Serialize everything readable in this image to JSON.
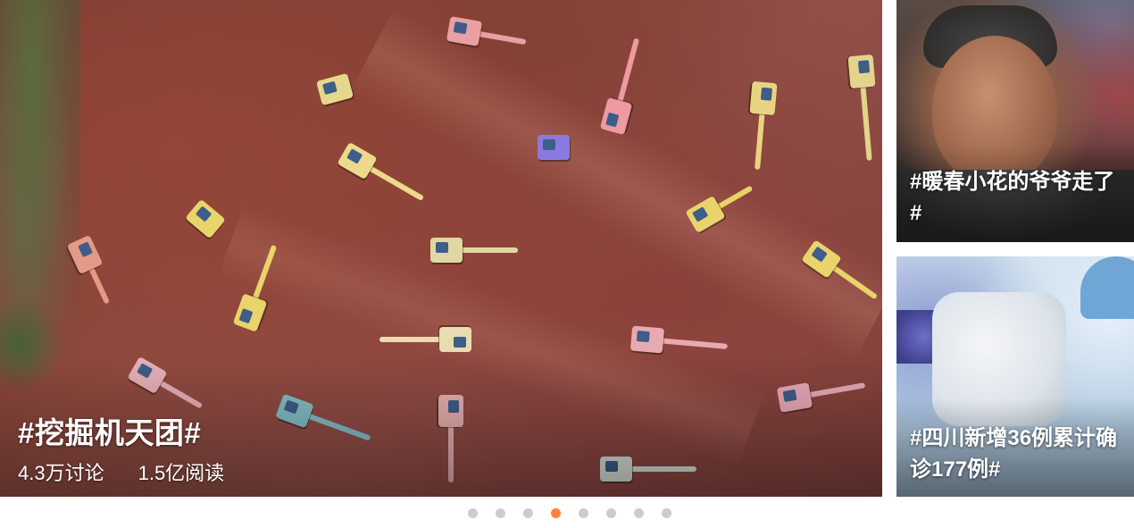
{
  "main_card": {
    "title": "#挖掘机天团#",
    "discussions": "4.3万讨论",
    "reads": "1.5亿阅读"
  },
  "side_cards": [
    {
      "title": "#暖春小花的爷爷走了#"
    },
    {
      "title": "#四川新增36例累计确诊177例#"
    }
  ],
  "carousel": {
    "total": 8,
    "active_index": 3,
    "colors": {
      "active": "#ff8138",
      "inactive": "#cccccc"
    }
  }
}
